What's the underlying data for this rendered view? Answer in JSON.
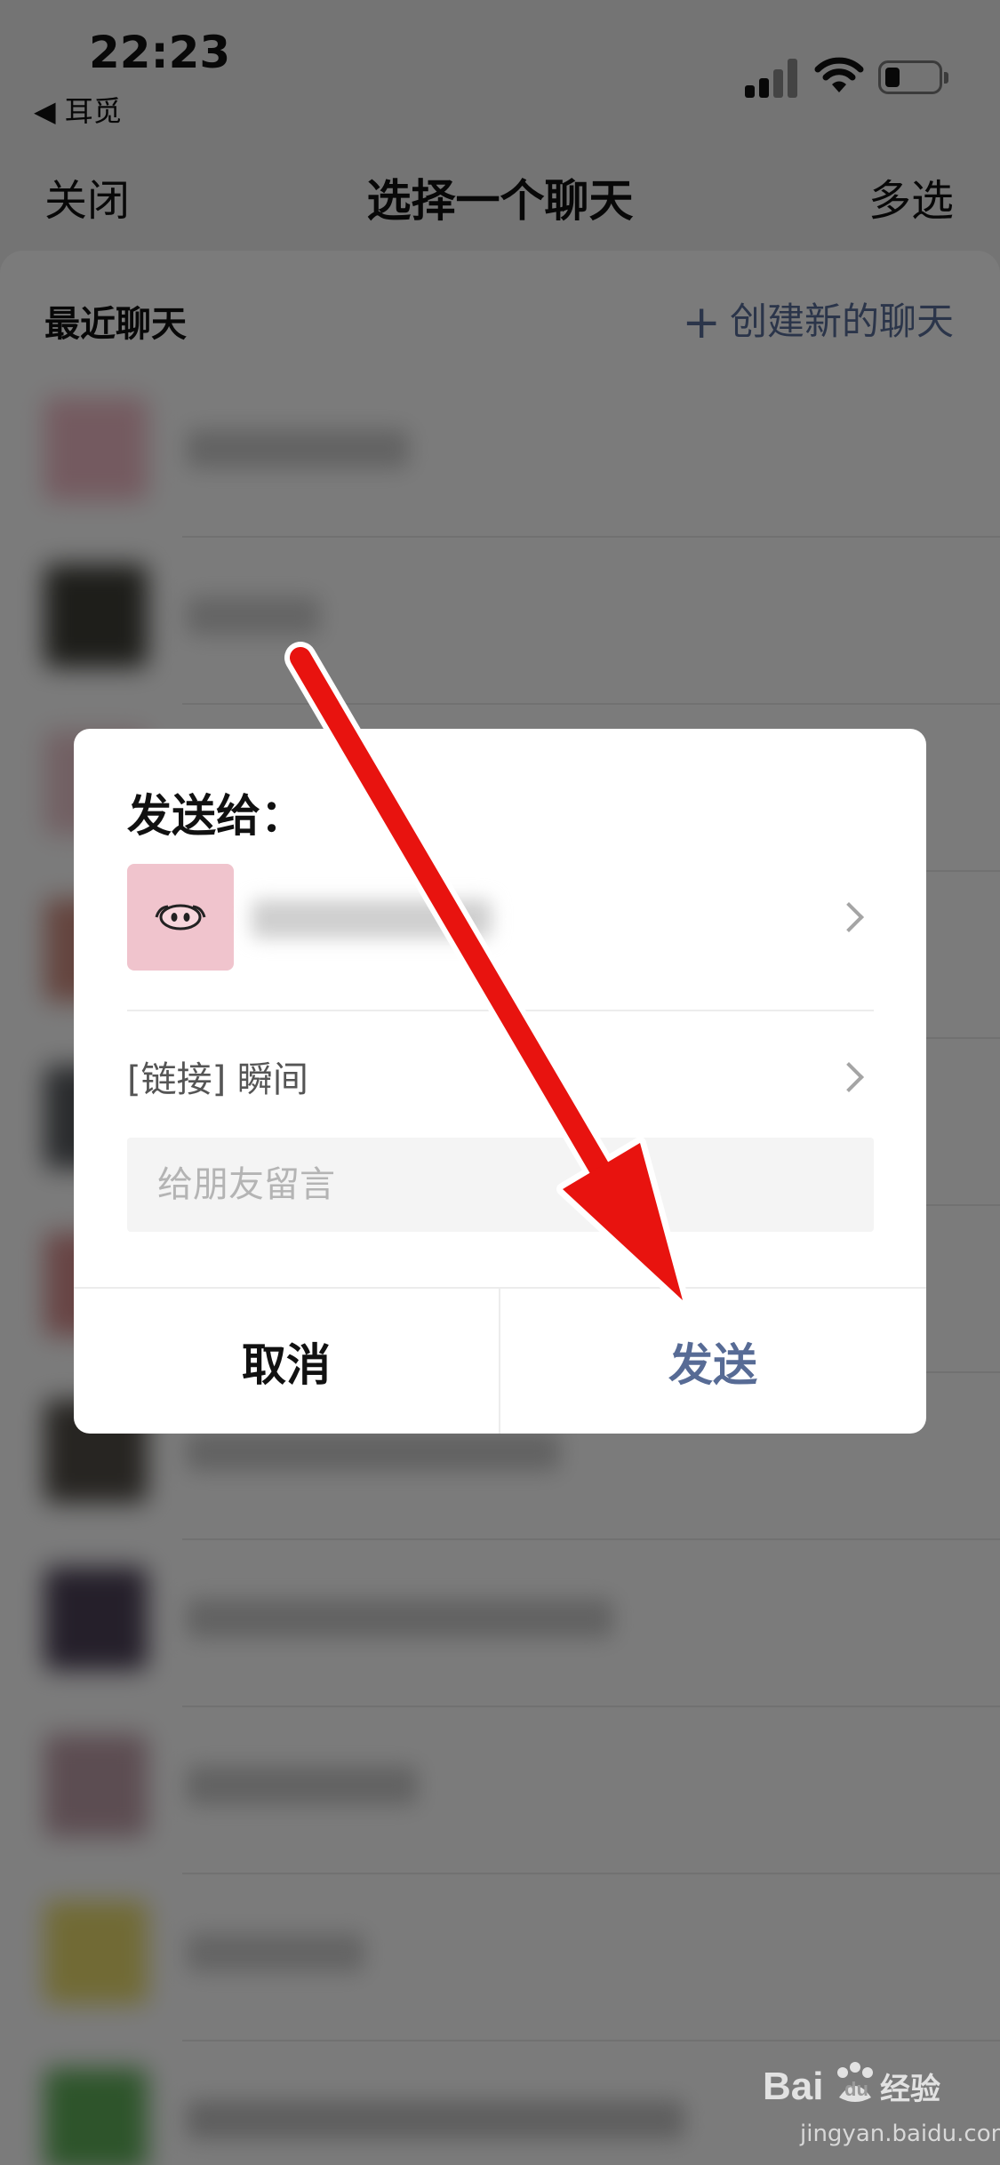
{
  "status_bar": {
    "time": "22:23",
    "back_app": "◀ 耳觅"
  },
  "nav": {
    "close": "关闭",
    "title": "选择一个聊天",
    "multi_select": "多选"
  },
  "list": {
    "section_label": "最近聊天",
    "create_plus": "+",
    "create_label": "创建新的聊天"
  },
  "dialog": {
    "title": "发送给：",
    "link_text": "[链接] 瞬间",
    "message_placeholder": "给朋友留言",
    "cancel_label": "取消",
    "send_label": "发送"
  },
  "watermark": {
    "domain": "jingyan.baidu.com"
  },
  "colors": {
    "accent": "#576b95",
    "annotation_arrow": "#e8130f"
  }
}
